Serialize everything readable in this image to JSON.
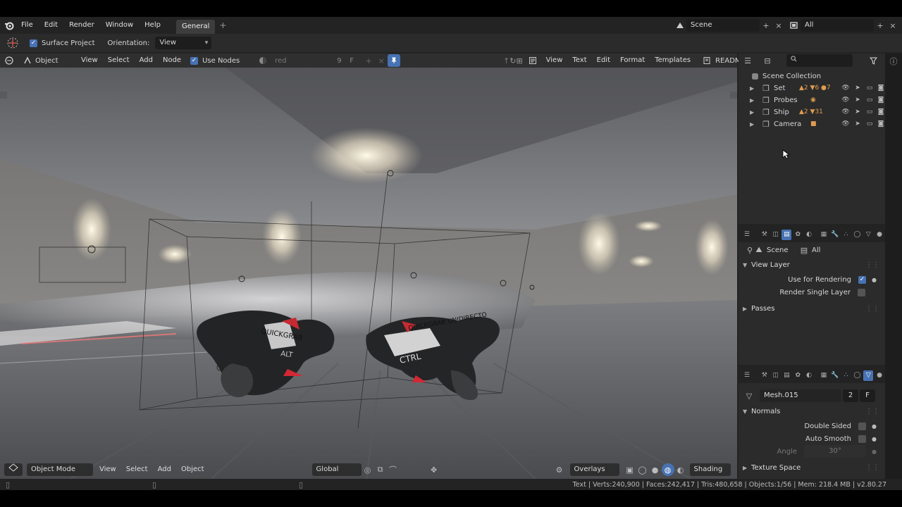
{
  "menu": {
    "items": [
      "File",
      "Edit",
      "Render",
      "Window",
      "Help"
    ]
  },
  "workspace": {
    "tab": "General",
    "add": "+"
  },
  "scene": {
    "name": "Scene",
    "add": "+",
    "close": "×"
  },
  "view_layer": {
    "name": "All",
    "add": "+",
    "close": "×"
  },
  "tool": {
    "surface_project_label": "Surface Project",
    "surface_project_checked": true,
    "orientation_label": "Orientation:",
    "orientation_value": "View"
  },
  "node_editor": {
    "object_type": "Object",
    "menus": [
      "View",
      "Select",
      "Add",
      "Node"
    ],
    "use_nodes_label": "Use Nodes",
    "material_name": "red",
    "users": "9",
    "fake_user": "F"
  },
  "text_editor": {
    "menus": [
      "View",
      "Text",
      "Edit",
      "Format",
      "Templates"
    ],
    "file_name": "README"
  },
  "outliner": {
    "collection": "Scene Collection",
    "items": [
      {
        "name": "Set",
        "counts": [
          "2",
          "6",
          "7"
        ]
      },
      {
        "name": "Probes",
        "counts": []
      },
      {
        "name": "Ship",
        "counts": [
          "2",
          "31"
        ]
      },
      {
        "name": "Camera",
        "counts": []
      }
    ]
  },
  "properties": {
    "scene": "Scene",
    "view_layer": "All",
    "view_layer_panel": "View Layer",
    "use_for_rendering": "Use for Rendering",
    "render_single_layer": "Render Single Layer",
    "passes": "Passes"
  },
  "mesh_props": {
    "mesh_name": "Mesh.015",
    "users": "2",
    "fake": "F",
    "normals": "Normals",
    "double_sided": "Double Sided",
    "auto_smooth": "Auto Smooth",
    "angle_label": "Angle",
    "angle_value": "30°",
    "texture_space": "Texture Space"
  },
  "viewport": {
    "mode": "Object Mode",
    "menus": [
      "View",
      "Select",
      "Add",
      "Object"
    ],
    "orientation": "Global",
    "overlays": "Overlays",
    "shading": "Shading",
    "labels": {
      "left_badge": "QUICKGRAB",
      "left_key": "ALT",
      "right_badge": "QUICKGRAB UNIDIRECTO",
      "right_key": "CTRL"
    }
  },
  "status": "Text | Verts:240,900 | Faces:242,417 | Tris:480,658 | Objects:1/56 | Mem: 218.4 MB | v2.80.27"
}
